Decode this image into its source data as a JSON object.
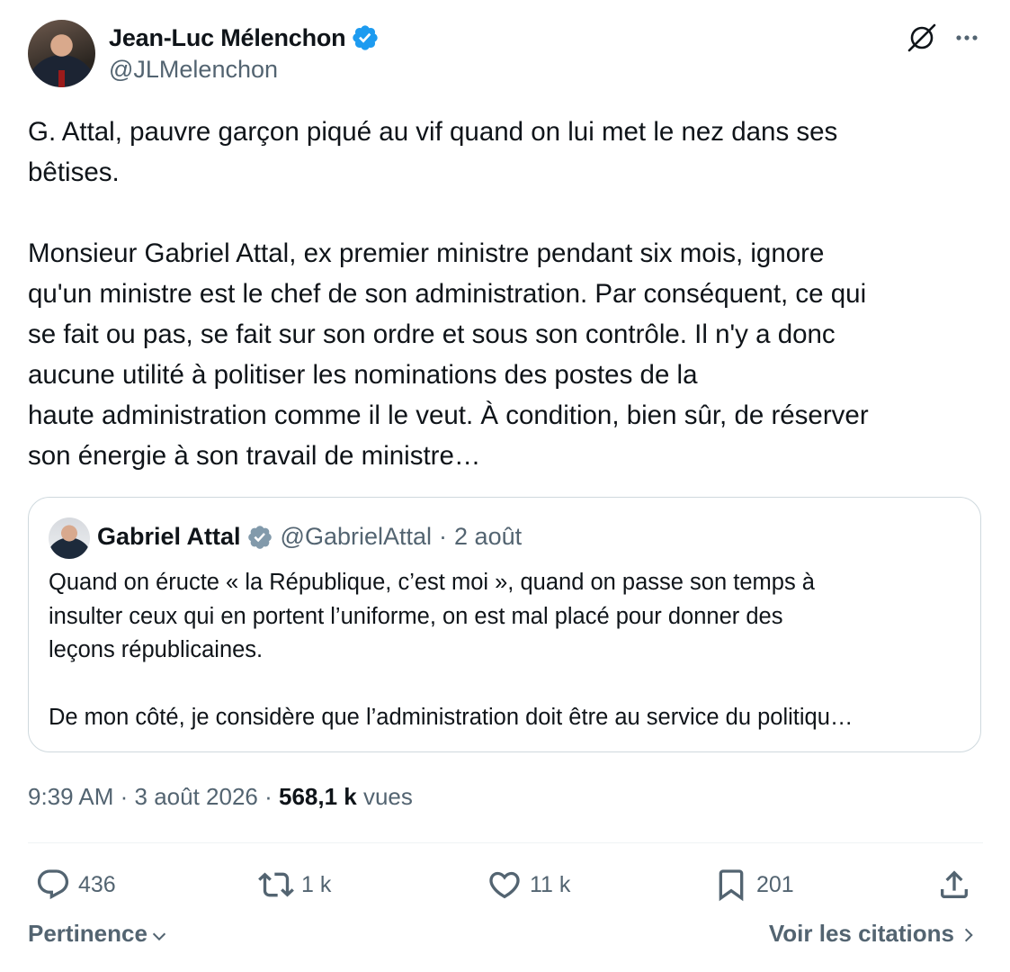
{
  "author": {
    "name": "Jean-Luc Mélenchon",
    "handle": "@JLMelenchon"
  },
  "icons": {
    "verified": "verified-badge-icon",
    "grok": "grok-icon",
    "more": "more-icon",
    "reply": "reply-icon",
    "retweet": "retweet-icon",
    "like": "like-icon",
    "bookmark": "bookmark-icon",
    "share": "share-icon"
  },
  "colors": {
    "verified_blue": "#1d9bf0",
    "verified_gray": "#829aab",
    "text_primary": "#0f1419",
    "text_secondary": "#536471"
  },
  "tweet": {
    "paragraphs": [
      "G. Attal, pauvre garçon piqué au vif quand on lui met le nez dans ses\nbêtises.",
      "Monsieur Gabriel Attal, ex premier ministre pendant six mois, ignore\nqu'un ministre est le chef de son administration. Par conséquent, ce qui\nse fait ou pas, se fait sur son ordre et sous son contrôle. Il n'y a donc\naucune utilité à politiser les nominations des postes de la\nhaute administration comme il le veut. À condition, bien sûr, de réserver\nson énergie à son travail de ministre…"
    ]
  },
  "quoted": {
    "name": "Gabriel Attal",
    "handle": "@GabrielAttal",
    "separator": "·",
    "date": "2 août",
    "paragraph1_lines": [
      "Quand on éructe « la République, c’est moi », quand on passe son temps à",
      "insulter ceux qui en portent l’uniforme, on est mal placé pour donner des",
      "leçons républicaines."
    ],
    "paragraph2": "De mon côté, je considère que l’administration doit être au service du politiqu…"
  },
  "meta": {
    "time": "9:39 AM",
    "sep1": " · ",
    "date": "3 août 2026",
    "sep2": " · ",
    "views_count": "568,1 k",
    "views_label": " vues"
  },
  "actions": {
    "replies": "436",
    "retweets": "1 k",
    "likes": "11 k",
    "bookmarks": "201"
  },
  "footer": {
    "sort_label": "Pertinence",
    "quotes_label": "Voir les citations"
  }
}
